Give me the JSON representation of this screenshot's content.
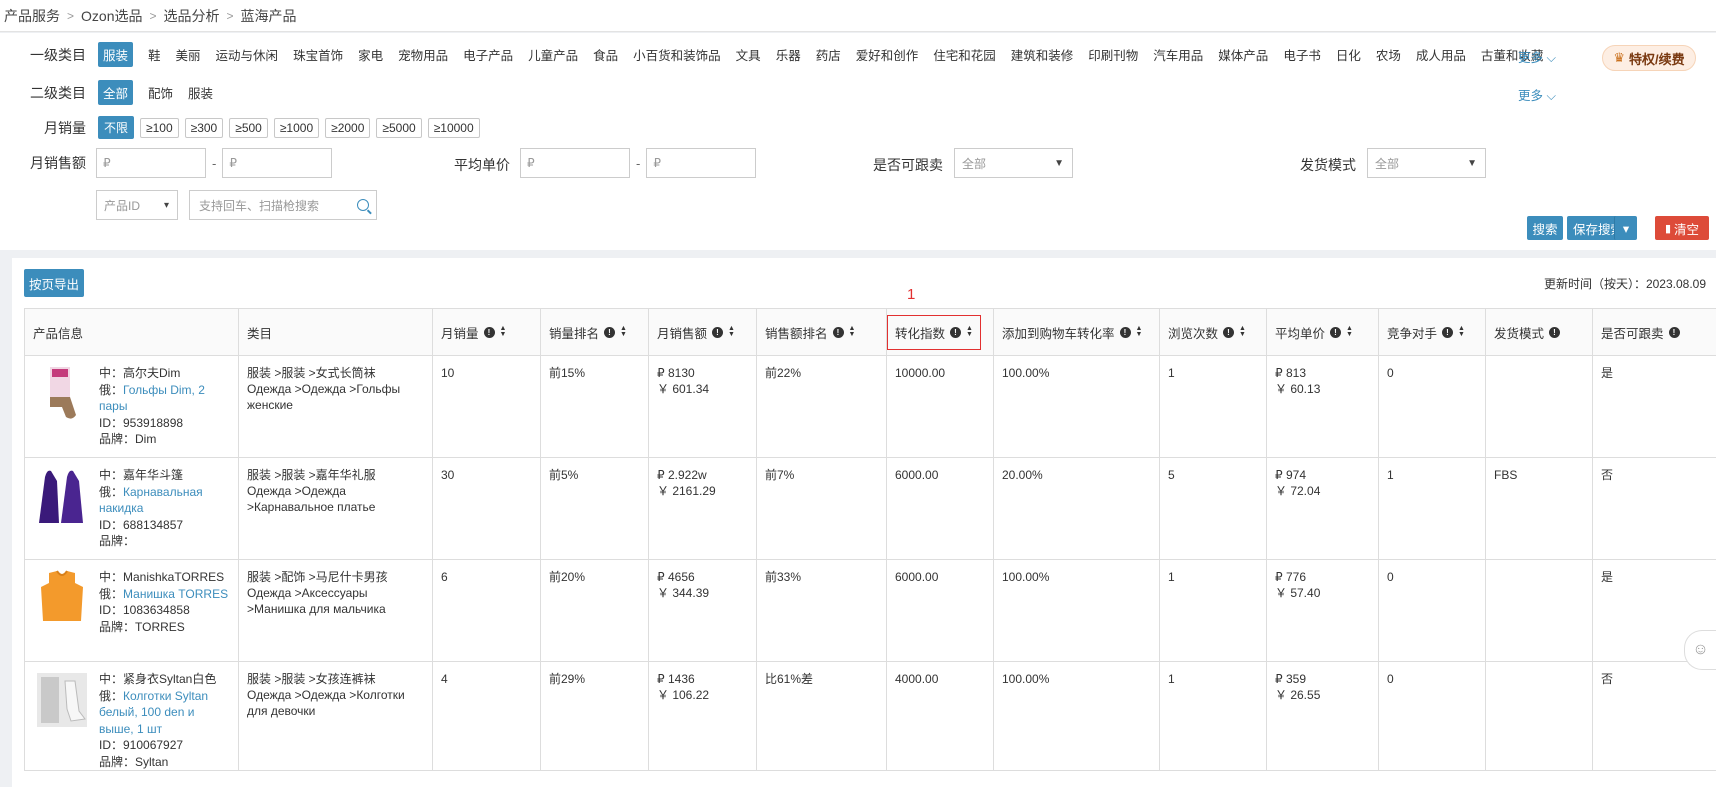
{
  "breadcrumb": [
    "产品服务",
    "Ozon选品",
    "选品分析",
    "蓝海产品"
  ],
  "filters": {
    "cat1": {
      "label": "一级类目",
      "options": [
        "服装",
        "鞋",
        "美丽",
        "运动与休闲",
        "珠宝首饰",
        "家电",
        "宠物用品",
        "电子产品",
        "儿童产品",
        "食品",
        "小百货和装饰品",
        "文具",
        "乐器",
        "药店",
        "爱好和创作",
        "住宅和花园",
        "建筑和装修",
        "印刷刊物",
        "汽车用品",
        "媒体产品",
        "电子书",
        "日化",
        "农场",
        "成人用品",
        "古董和收藏"
      ],
      "more": "更多"
    },
    "cat2": {
      "label": "二级类目",
      "options": [
        "全部",
        "配饰",
        "服装"
      ],
      "more": "更多"
    },
    "monthly_sales": {
      "label": "月销量",
      "options": [
        "不限",
        "≥100",
        "≥300",
        "≥500",
        "≥1000",
        "≥2000",
        "≥5000",
        "≥10000"
      ]
    },
    "monthly_revenue": {
      "label": "月销售额",
      "min_placeholder": "₽",
      "max_placeholder": "₽"
    },
    "avg_price": {
      "label": "平均单价",
      "min_placeholder": "₽",
      "max_placeholder": "₽"
    },
    "follow_sell": {
      "label": "是否可跟卖",
      "value": "全部"
    },
    "ship_mode": {
      "label": "发货模式",
      "value": "全部"
    },
    "id_type": "产品ID",
    "search_placeholder": "支持回车、扫描枪搜索",
    "vip": "特权/续费",
    "buttons": {
      "search": "搜索",
      "save_search": "保存搜索",
      "clear": "清空"
    }
  },
  "table": {
    "export": "按页导出",
    "update_time": "更新时间（按天）：2023.08.09",
    "marker": "1",
    "columns": [
      "产品信息",
      "类目",
      "月销量",
      "销量排名",
      "月销售额",
      "销售额排名",
      "转化指数",
      "添加到购物车转化率",
      "浏览次数",
      "平均单价",
      "竞争对手",
      "发货模式",
      "是否可跟卖"
    ],
    "rows": [
      {
        "cn": "中：高尔夫Dim",
        "ru_prefix": "俄：",
        "ru": "Гольфы Dim, 2 пары",
        "id": "ID：953918898",
        "brand": "品牌：Dim",
        "cat_cn": "服装 >服装 >女式长筒袜",
        "cat_ru": "Одежда >Одежда >Гольфы женские",
        "sales": "10",
        "sales_rank": "前15%",
        "rev_rub": "₽ 8130",
        "rev_cny": "￥ 601.34",
        "rev_rank": "前22%",
        "conv": "10000.00",
        "cart": "100.00%",
        "views": "1",
        "price_rub": "₽ 813",
        "price_cny": "￥ 60.13",
        "rivals": "0",
        "ship": "",
        "follow": "是"
      },
      {
        "cn": "中：嘉年华斗篷",
        "ru_prefix": "俄：",
        "ru": "Карнавальная накидка",
        "id": "ID：688134857",
        "brand": "品牌：",
        "cat_cn": "服装 >服装 >嘉年华礼服",
        "cat_ru": "Одежда >Одежда >Карнавальное платье",
        "sales": "30",
        "sales_rank": "前5%",
        "rev_rub": "₽ 2.922w",
        "rev_cny": "￥ 2161.29",
        "rev_rank": "前7%",
        "conv": "6000.00",
        "cart": "20.00%",
        "views": "5",
        "price_rub": "₽ 974",
        "price_cny": "￥ 72.04",
        "rivals": "1",
        "ship": "FBS",
        "follow": "否"
      },
      {
        "cn": "中：ManishkaTORRES",
        "ru_prefix": "俄：",
        "ru": "Манишка TORRES",
        "id": "ID：1083634858",
        "brand": "品牌：TORRES",
        "cat_cn": "服装 >配饰 >马尼什卡男孩",
        "cat_ru": "Одежда >Аксессуары >Манишка для мальчика",
        "sales": "6",
        "sales_rank": "前20%",
        "rev_rub": "₽ 4656",
        "rev_cny": "￥ 344.39",
        "rev_rank": "前33%",
        "conv": "6000.00",
        "cart": "100.00%",
        "views": "1",
        "price_rub": "₽ 776",
        "price_cny": "￥ 57.40",
        "rivals": "0",
        "ship": "",
        "follow": "是"
      },
      {
        "cn": "中：紧身衣Syltan白色",
        "ru_prefix": "俄：",
        "ru": "Колготки Syltan белый, 100 den и выше, 1 шт",
        "id": "ID：910067927",
        "brand": "品牌：Syltan",
        "cat_cn": "服装 >服装 >女孩连裤袜",
        "cat_ru": "Одежда >Одежда >Колготки для девочки",
        "sales": "4",
        "sales_rank": "前29%",
        "rev_rub": "₽ 1436",
        "rev_cny": "￥ 106.22",
        "rev_rank": "比61%差",
        "conv": "4000.00",
        "cart": "100.00%",
        "views": "1",
        "price_rub": "₽ 359",
        "price_cny": "￥ 26.55",
        "rivals": "0",
        "ship": "",
        "follow": "否"
      }
    ]
  }
}
